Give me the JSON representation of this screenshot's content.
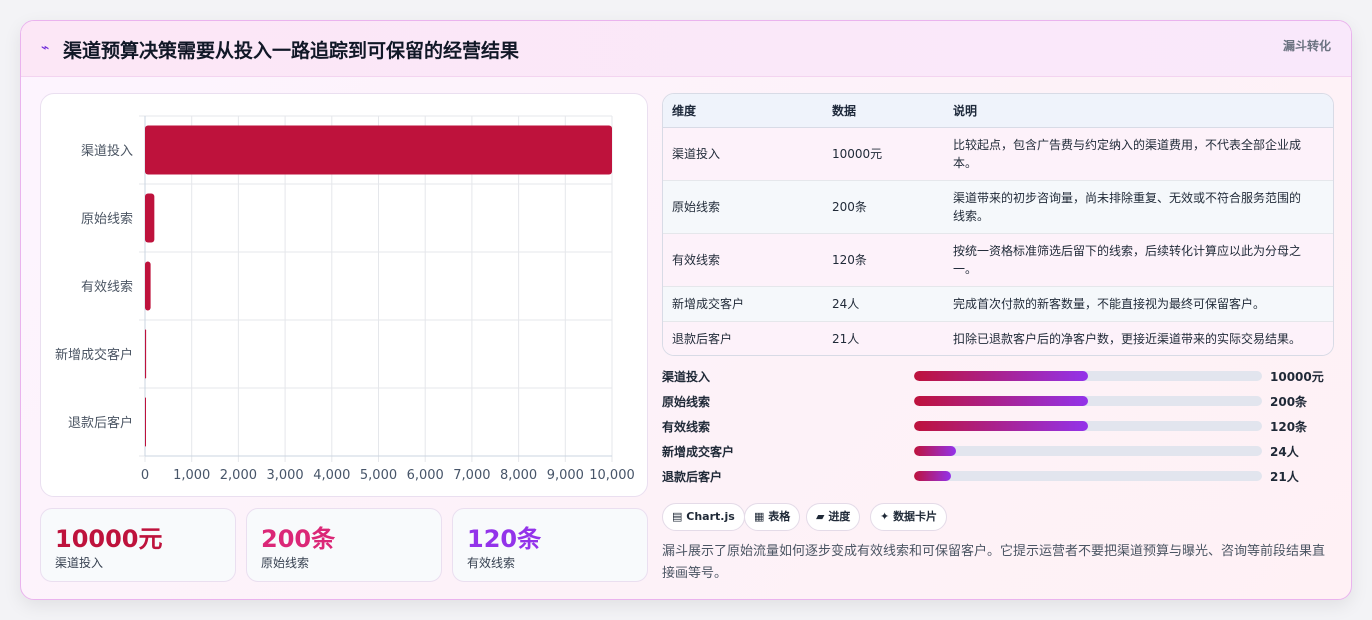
{
  "header": {
    "title": "渠道预算决策需要从投入一路追踪到可保留的经营结果",
    "title_icon": "spark-icon",
    "tag": "漏斗转化"
  },
  "chart_data": {
    "type": "bar",
    "orientation": "horizontal",
    "categories": [
      "渠道投入",
      "原始线索",
      "有效线索",
      "新增成交客户",
      "退款后客户"
    ],
    "values": [
      10000,
      200,
      120,
      24,
      21
    ],
    "xlim": [
      0,
      10000
    ],
    "xticks": [
      "0",
      "1,000",
      "2,000",
      "3,000",
      "4,000",
      "5,000",
      "6,000",
      "7,000",
      "8,000",
      "9,000",
      "10,000"
    ],
    "grid": true,
    "bar_color": "#be123c"
  },
  "kpis": [
    {
      "value": "10000元",
      "label": "渠道投入",
      "color": "#be123c"
    },
    {
      "value": "200条",
      "label": "原始线索",
      "color": "#db2777"
    },
    {
      "value": "120条",
      "label": "有效线索",
      "color": "#9333ea"
    }
  ],
  "table": {
    "headers": [
      "维度",
      "数据",
      "说明"
    ],
    "rows": [
      [
        "渠道投入",
        "10000元",
        "比较起点，包含广告费与约定纳入的渠道费用，不代表全部企业成本。"
      ],
      [
        "原始线索",
        "200条",
        "渠道带来的初步咨询量，尚未排除重复、无效或不符合服务范围的线索。"
      ],
      [
        "有效线索",
        "120条",
        "按统一资格标准筛选后留下的线索，后续转化计算应以此为分母之一。"
      ],
      [
        "新增成交客户",
        "24人",
        "完成首次付款的新客数量，不能直接视为最终可保留客户。"
      ],
      [
        "退款后客户",
        "21人",
        "扣除已退款客户后的净客户数，更接近渠道带来的实际交易结果。"
      ]
    ]
  },
  "progress": [
    {
      "label": "渠道投入",
      "value": "10000元",
      "fraction": 0.5
    },
    {
      "label": "原始线索",
      "value": "200条",
      "fraction": 0.5
    },
    {
      "label": "有效线索",
      "value": "120条",
      "fraction": 0.5
    },
    {
      "label": "新增成交客户",
      "value": "24人",
      "fraction": 0.12
    },
    {
      "label": "退款后客户",
      "value": "21人",
      "fraction": 0.105
    }
  ],
  "chips": [
    {
      "icon": "chart-icon",
      "glyph": "▤",
      "label": "Chart.js"
    },
    {
      "icon": "table-icon",
      "glyph": "▦",
      "label": "表格"
    },
    {
      "icon": "progress-icon",
      "glyph": "▰",
      "label": "进度"
    },
    {
      "icon": "card-icon",
      "glyph": "✦",
      "label": "数据卡片"
    }
  ],
  "description": "漏斗展示了原始流量如何逐步变成有效线索和可保留客户。它提示运营者不要把渠道预算与曝光、咨询等前段结果直接画等号。"
}
